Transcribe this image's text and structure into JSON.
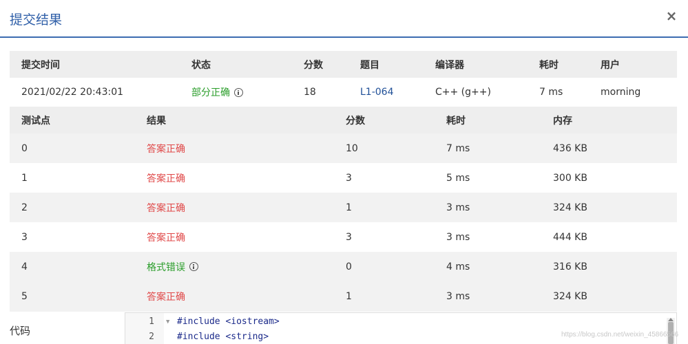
{
  "modal": {
    "title": "提交结果",
    "close": "×"
  },
  "summary": {
    "headers": [
      "提交时间",
      "状态",
      "分数",
      "题目",
      "编译器",
      "耗时",
      "用户"
    ],
    "row": {
      "time": "2021/02/22 20:43:01",
      "status": "部分正确",
      "score": "18",
      "problem": "L1-064",
      "compiler": "C++ (g++)",
      "duration": "7 ms",
      "user": "morning"
    }
  },
  "tests": {
    "headers": [
      "测试点",
      "结果",
      "分数",
      "耗时",
      "内存"
    ],
    "rows": [
      {
        "id": "0",
        "result": "答案正确",
        "score": "10",
        "time": "7 ms",
        "memory": "436 KB"
      },
      {
        "id": "1",
        "result": "答案正确",
        "score": "3",
        "time": "5 ms",
        "memory": "300 KB"
      },
      {
        "id": "2",
        "result": "答案正确",
        "score": "1",
        "time": "3 ms",
        "memory": "324 KB"
      },
      {
        "id": "3",
        "result": "答案正确",
        "score": "3",
        "time": "3 ms",
        "memory": "444 KB"
      },
      {
        "id": "4",
        "result": "格式错误",
        "score": "0",
        "time": "4 ms",
        "memory": "316 KB"
      },
      {
        "id": "5",
        "result": "答案正确",
        "score": "1",
        "time": "3 ms",
        "memory": "324 KB"
      }
    ]
  },
  "code": {
    "label": "代码",
    "lines": [
      {
        "num": "1",
        "text": "#include <iostream>"
      },
      {
        "num": "2",
        "text": "#include <string>"
      }
    ]
  },
  "watermark": "https://blog.csdn.net/weixin_45866566",
  "colors": {
    "accent": "#2f5fa8",
    "correct_red": "#e04848",
    "partial_green": "#2a9d2a"
  }
}
